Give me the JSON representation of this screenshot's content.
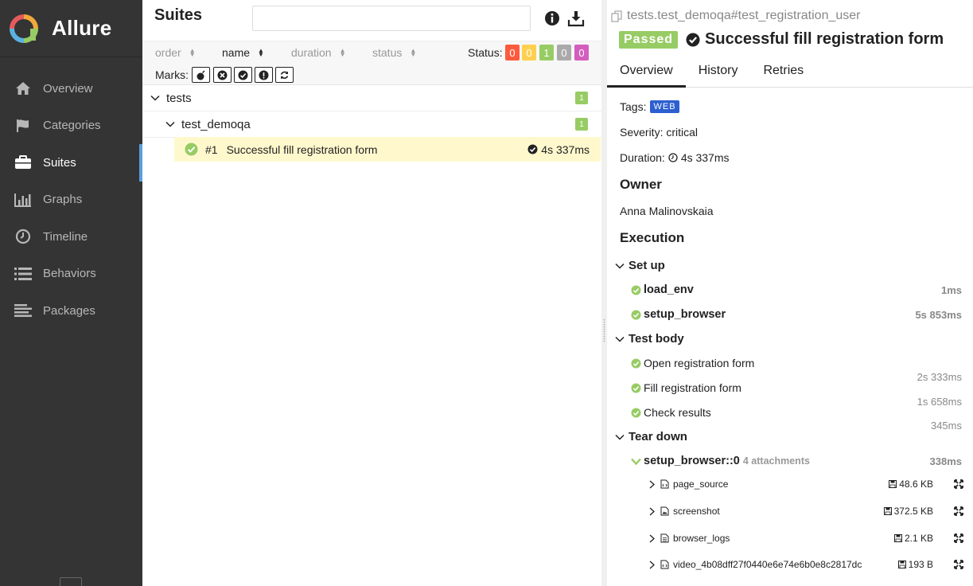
{
  "brand": {
    "name": "Allure"
  },
  "nav": [
    {
      "label": "Overview",
      "icon": "home-icon"
    },
    {
      "label": "Categories",
      "icon": "flag-icon"
    },
    {
      "label": "Suites",
      "icon": "briefcase-icon",
      "active": true
    },
    {
      "label": "Graphs",
      "icon": "bar-chart-icon"
    },
    {
      "label": "Timeline",
      "icon": "clock-icon"
    },
    {
      "label": "Behaviors",
      "icon": "list-icon"
    },
    {
      "label": "Packages",
      "icon": "align-left-icon"
    }
  ],
  "suites": {
    "title": "Suites",
    "search_placeholder": "",
    "sort": {
      "order": "order",
      "name": "name",
      "duration": "duration",
      "status": "status"
    },
    "status_label": "Status:",
    "status_counts": [
      {
        "value": "0",
        "color": "#fd5a3e"
      },
      {
        "value": "0",
        "color": "#ffd050"
      },
      {
        "value": "1",
        "color": "#97cc64"
      },
      {
        "value": "0",
        "color": "#aaaaaa"
      },
      {
        "value": "0",
        "color": "#d35ebe"
      }
    ],
    "marks_label": "Marks:",
    "tree": {
      "root": {
        "name": "tests",
        "count": "1"
      },
      "child": {
        "name": "test_demoqa",
        "count": "1"
      },
      "test": {
        "number": "#1",
        "name": "Successful fill registration form",
        "duration": "4s 337ms"
      }
    }
  },
  "detail": {
    "breadcrumb": "tests.test_demoqa#test_registration_user",
    "status": "Passed",
    "title": "Successful fill registration form",
    "tabs": [
      "Overview",
      "History",
      "Retries"
    ],
    "tags_label": "Tags:",
    "tag": "WEB",
    "severity": "Severity: critical",
    "duration_label": "Duration:",
    "duration": "4s 337ms",
    "owner_heading": "Owner",
    "owner": "Anna Malinovskaia",
    "execution_heading": "Execution",
    "setup": {
      "label": "Set up",
      "steps": [
        {
          "name": "load_env",
          "duration": "1ms"
        },
        {
          "name": "setup_browser",
          "duration": "5s 853ms"
        }
      ]
    },
    "body": {
      "label": "Test body",
      "steps": [
        {
          "name": "Open registration form",
          "duration": "2s 333ms"
        },
        {
          "name": "Fill registration form",
          "duration": "1s 658ms"
        },
        {
          "name": "Check results",
          "duration": "345ms"
        }
      ]
    },
    "teardown": {
      "label": "Tear down",
      "step": {
        "name": "setup_browser::0",
        "attachments": "4 attachments",
        "duration": "338ms"
      },
      "attachments": [
        {
          "name": "page_source",
          "size": "48.6 KB"
        },
        {
          "name": "screenshot",
          "size": "372.5 KB"
        },
        {
          "name": "browser_logs",
          "size": "2.1 KB"
        },
        {
          "name": "video_4b08dff27f0440e6e74e6b0e8c2817dc",
          "size": "193 B"
        }
      ]
    }
  }
}
